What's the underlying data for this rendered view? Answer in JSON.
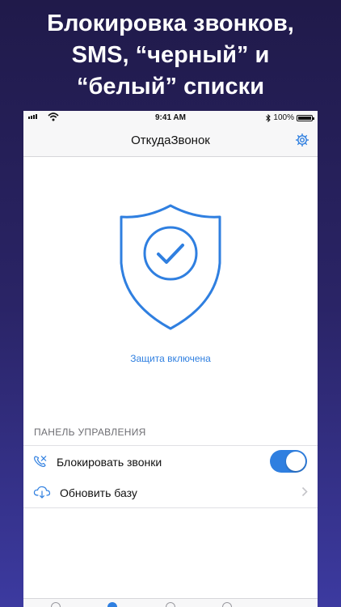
{
  "promo": {
    "line1": "Блокировка звонков,",
    "line2": "SMS, “черный” и",
    "line3": "“белый” списки"
  },
  "status_bar": {
    "time": "9:41 AM",
    "battery": "100%"
  },
  "nav": {
    "title": "ОткудаЗвонок",
    "settings_icon": "gear-icon"
  },
  "protection": {
    "status_text": "Защита включена",
    "icon": "shield-check-icon",
    "color": "#2f7fe0"
  },
  "control_panel": {
    "header": "ПАНЕЛЬ УПРАВЛЕНИЯ",
    "items": [
      {
        "label": "Блокировать звонки",
        "icon": "phone-block-icon",
        "control": "toggle",
        "enabled": true
      },
      {
        "label": "Обновить базу",
        "icon": "cloud-download-icon",
        "control": "chevron"
      }
    ]
  },
  "colors": {
    "accent": "#2f7fe0",
    "background_top": "#201a4a",
    "background_bottom": "#3c3aa0"
  }
}
